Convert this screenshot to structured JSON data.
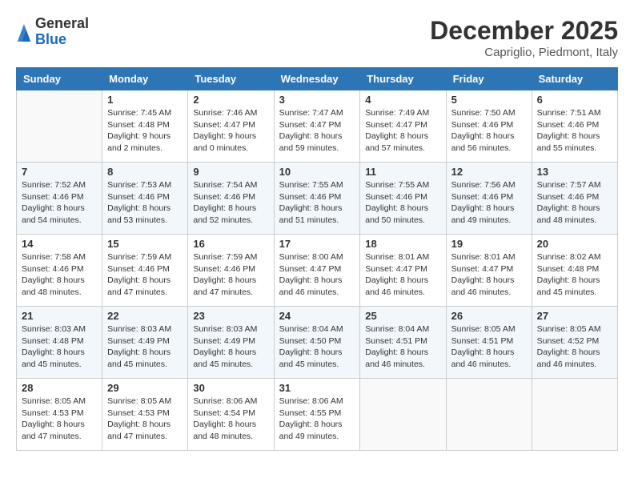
{
  "header": {
    "logo": {
      "general": "General",
      "blue": "Blue"
    },
    "title": "December 2025",
    "location": "Capriglio, Piedmont, Italy"
  },
  "days_of_week": [
    "Sunday",
    "Monday",
    "Tuesday",
    "Wednesday",
    "Thursday",
    "Friday",
    "Saturday"
  ],
  "weeks": [
    [
      {
        "day": "",
        "info": ""
      },
      {
        "day": "1",
        "info": "Sunrise: 7:45 AM\nSunset: 4:48 PM\nDaylight: 9 hours\nand 2 minutes."
      },
      {
        "day": "2",
        "info": "Sunrise: 7:46 AM\nSunset: 4:47 PM\nDaylight: 9 hours\nand 0 minutes."
      },
      {
        "day": "3",
        "info": "Sunrise: 7:47 AM\nSunset: 4:47 PM\nDaylight: 8 hours\nand 59 minutes."
      },
      {
        "day": "4",
        "info": "Sunrise: 7:49 AM\nSunset: 4:47 PM\nDaylight: 8 hours\nand 57 minutes."
      },
      {
        "day": "5",
        "info": "Sunrise: 7:50 AM\nSunset: 4:46 PM\nDaylight: 8 hours\nand 56 minutes."
      },
      {
        "day": "6",
        "info": "Sunrise: 7:51 AM\nSunset: 4:46 PM\nDaylight: 8 hours\nand 55 minutes."
      }
    ],
    [
      {
        "day": "7",
        "info": "Sunrise: 7:52 AM\nSunset: 4:46 PM\nDaylight: 8 hours\nand 54 minutes."
      },
      {
        "day": "8",
        "info": "Sunrise: 7:53 AM\nSunset: 4:46 PM\nDaylight: 8 hours\nand 53 minutes."
      },
      {
        "day": "9",
        "info": "Sunrise: 7:54 AM\nSunset: 4:46 PM\nDaylight: 8 hours\nand 52 minutes."
      },
      {
        "day": "10",
        "info": "Sunrise: 7:55 AM\nSunset: 4:46 PM\nDaylight: 8 hours\nand 51 minutes."
      },
      {
        "day": "11",
        "info": "Sunrise: 7:55 AM\nSunset: 4:46 PM\nDaylight: 8 hours\nand 50 minutes."
      },
      {
        "day": "12",
        "info": "Sunrise: 7:56 AM\nSunset: 4:46 PM\nDaylight: 8 hours\nand 49 minutes."
      },
      {
        "day": "13",
        "info": "Sunrise: 7:57 AM\nSunset: 4:46 PM\nDaylight: 8 hours\nand 48 minutes."
      }
    ],
    [
      {
        "day": "14",
        "info": "Sunrise: 7:58 AM\nSunset: 4:46 PM\nDaylight: 8 hours\nand 48 minutes."
      },
      {
        "day": "15",
        "info": "Sunrise: 7:59 AM\nSunset: 4:46 PM\nDaylight: 8 hours\nand 47 minutes."
      },
      {
        "day": "16",
        "info": "Sunrise: 7:59 AM\nSunset: 4:46 PM\nDaylight: 8 hours\nand 47 minutes."
      },
      {
        "day": "17",
        "info": "Sunrise: 8:00 AM\nSunset: 4:47 PM\nDaylight: 8 hours\nand 46 minutes."
      },
      {
        "day": "18",
        "info": "Sunrise: 8:01 AM\nSunset: 4:47 PM\nDaylight: 8 hours\nand 46 minutes."
      },
      {
        "day": "19",
        "info": "Sunrise: 8:01 AM\nSunset: 4:47 PM\nDaylight: 8 hours\nand 46 minutes."
      },
      {
        "day": "20",
        "info": "Sunrise: 8:02 AM\nSunset: 4:48 PM\nDaylight: 8 hours\nand 45 minutes."
      }
    ],
    [
      {
        "day": "21",
        "info": "Sunrise: 8:03 AM\nSunset: 4:48 PM\nDaylight: 8 hours\nand 45 minutes."
      },
      {
        "day": "22",
        "info": "Sunrise: 8:03 AM\nSunset: 4:49 PM\nDaylight: 8 hours\nand 45 minutes."
      },
      {
        "day": "23",
        "info": "Sunrise: 8:03 AM\nSunset: 4:49 PM\nDaylight: 8 hours\nand 45 minutes."
      },
      {
        "day": "24",
        "info": "Sunrise: 8:04 AM\nSunset: 4:50 PM\nDaylight: 8 hours\nand 45 minutes."
      },
      {
        "day": "25",
        "info": "Sunrise: 8:04 AM\nSunset: 4:51 PM\nDaylight: 8 hours\nand 46 minutes."
      },
      {
        "day": "26",
        "info": "Sunrise: 8:05 AM\nSunset: 4:51 PM\nDaylight: 8 hours\nand 46 minutes."
      },
      {
        "day": "27",
        "info": "Sunrise: 8:05 AM\nSunset: 4:52 PM\nDaylight: 8 hours\nand 46 minutes."
      }
    ],
    [
      {
        "day": "28",
        "info": "Sunrise: 8:05 AM\nSunset: 4:53 PM\nDaylight: 8 hours\nand 47 minutes."
      },
      {
        "day": "29",
        "info": "Sunrise: 8:05 AM\nSunset: 4:53 PM\nDaylight: 8 hours\nand 47 minutes."
      },
      {
        "day": "30",
        "info": "Sunrise: 8:06 AM\nSunset: 4:54 PM\nDaylight: 8 hours\nand 48 minutes."
      },
      {
        "day": "31",
        "info": "Sunrise: 8:06 AM\nSunset: 4:55 PM\nDaylight: 8 hours\nand 49 minutes."
      },
      {
        "day": "",
        "info": ""
      },
      {
        "day": "",
        "info": ""
      },
      {
        "day": "",
        "info": ""
      }
    ]
  ]
}
